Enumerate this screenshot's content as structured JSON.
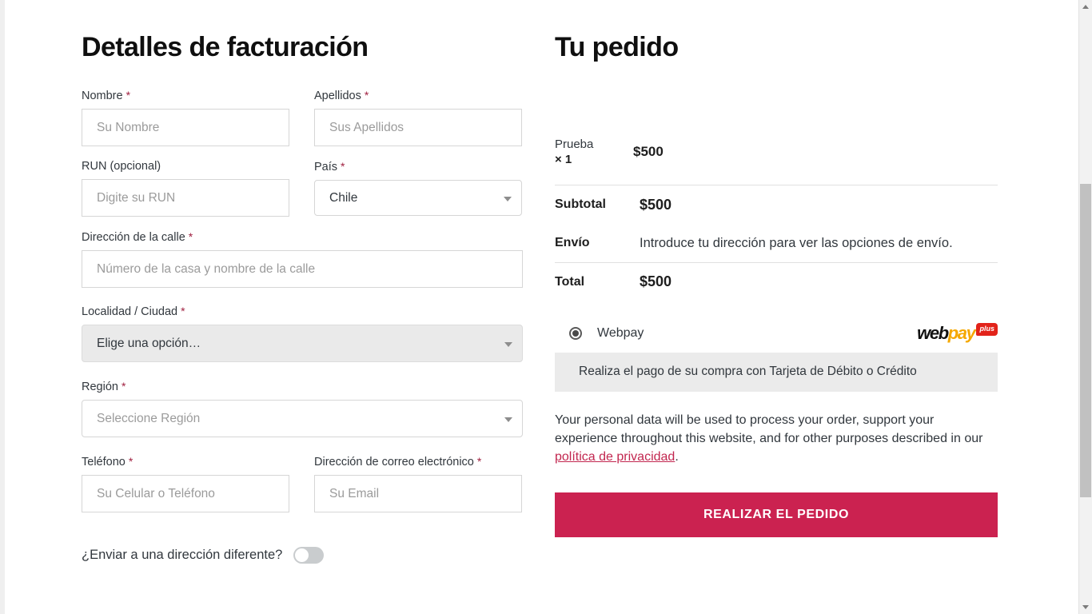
{
  "billing": {
    "title": "Detalles de facturación",
    "required_mark": "*",
    "fields": [
      {
        "label": "Nombre",
        "required": true,
        "placeholder": "Su Nombre",
        "value": "",
        "type": "text"
      },
      {
        "label": "Apellidos",
        "required": true,
        "placeholder": "Sus Apellidos",
        "value": "",
        "type": "text"
      },
      {
        "label": "RUN (opcional)",
        "required": false,
        "placeholder": "Digite su RUN",
        "value": "",
        "type": "text"
      },
      {
        "label": "País",
        "required": true,
        "placeholder": "",
        "value": "Chile",
        "type": "select"
      },
      {
        "label": "Dirección de la calle",
        "required": true,
        "placeholder": "Número de la casa y nombre de la calle",
        "value": "",
        "type": "text"
      },
      {
        "label": "Localidad / Ciudad",
        "required": true,
        "placeholder": "Elige una opción…",
        "value": "Elige una opción…",
        "type": "select"
      },
      {
        "label": "Región",
        "required": true,
        "placeholder": "Seleccione Región",
        "value": "",
        "type": "select"
      },
      {
        "label": "Teléfono",
        "required": true,
        "placeholder": "Su Celular o Teléfono",
        "value": "",
        "type": "text"
      },
      {
        "label": "Dirección de correo electrónico",
        "required": true,
        "placeholder": "Su Email",
        "value": "",
        "type": "text"
      }
    ],
    "ship_different": {
      "label": "¿Enviar a una dirección diferente?",
      "checked": false
    }
  },
  "order": {
    "title": "Tu pedido",
    "product": {
      "name": "Prueba",
      "quantity": "× 1",
      "total": "$500"
    },
    "totals": [
      {
        "label": "Subtotal",
        "value": "$500"
      },
      {
        "label": "Envío",
        "value": "Introduce tu dirección para ver las opciones de envío."
      },
      {
        "label": "Total",
        "value": "$500"
      }
    ],
    "payment": {
      "method_label": "Webpay",
      "selected": true,
      "logo": {
        "part1": "web",
        "part2": "pay",
        "badge": "plus",
        "color_part1": "#121212",
        "color_part2": "#f5a800",
        "color_badge_bg": "#e2231a"
      },
      "description": "Realiza el pago de su compra con Tarjeta de Débito o Crédito"
    },
    "privacy_text_before": "Your personal data will be used to process your order, support your experience throughout this website, and for other purposes described in our ",
    "privacy_link": "política de privacidad",
    "privacy_text_after": ".",
    "place_order_label": "REALIZAR EL PEDIDO",
    "accent_color": "#cb2250"
  }
}
